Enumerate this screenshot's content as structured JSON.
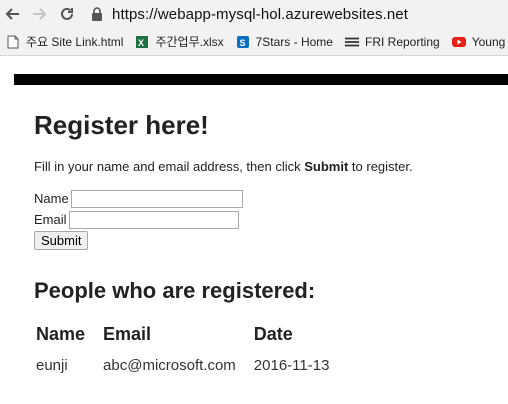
{
  "browser": {
    "url": "https://webapp-mysql-hol.azurewebsites.net",
    "bookmarks": [
      {
        "label": "주요 Site Link.html",
        "icon": "document-icon"
      },
      {
        "label": "주간업무.xlsx",
        "icon": "excel-icon"
      },
      {
        "label": "7Stars - Home",
        "icon": "sharepoint-icon"
      },
      {
        "label": "FRI Reporting",
        "icon": "menu-icon"
      },
      {
        "label": "Young",
        "icon": "youtube-icon"
      }
    ]
  },
  "page": {
    "title": "Register here!",
    "lead_prefix": "Fill in your name and email address, then click ",
    "lead_bold": "Submit",
    "lead_suffix": " to register.",
    "name_label": "Name",
    "email_label": "Email",
    "name_value": "",
    "email_value": "",
    "submit_label": "Submit",
    "registered_heading": "People who are registered:",
    "table": {
      "headers": [
        "Name",
        "Email",
        "Date"
      ],
      "rows": [
        [
          "eunji",
          "abc@microsoft.com",
          "2016-11-13"
        ]
      ]
    }
  }
}
